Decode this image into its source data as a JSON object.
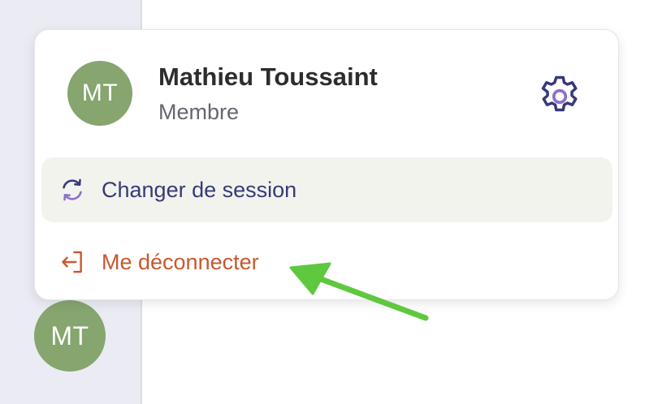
{
  "sidebar": {
    "avatar_initials": "MT"
  },
  "profile_menu": {
    "avatar_initials": "MT",
    "user_name": "Mathieu Toussaint",
    "user_role": "Membre",
    "settings_icon": "gear-icon",
    "items": [
      {
        "label": "Changer de session",
        "icon": "refresh-icon"
      },
      {
        "label": "Me déconnecter",
        "icon": "logout-icon"
      }
    ]
  },
  "colors": {
    "avatar_bg": "#86a56f",
    "primary_text": "#363a78",
    "danger_text": "#c8582f",
    "highlight_bg": "#f3f3ee",
    "annotation_arrow": "#5ec83f"
  }
}
